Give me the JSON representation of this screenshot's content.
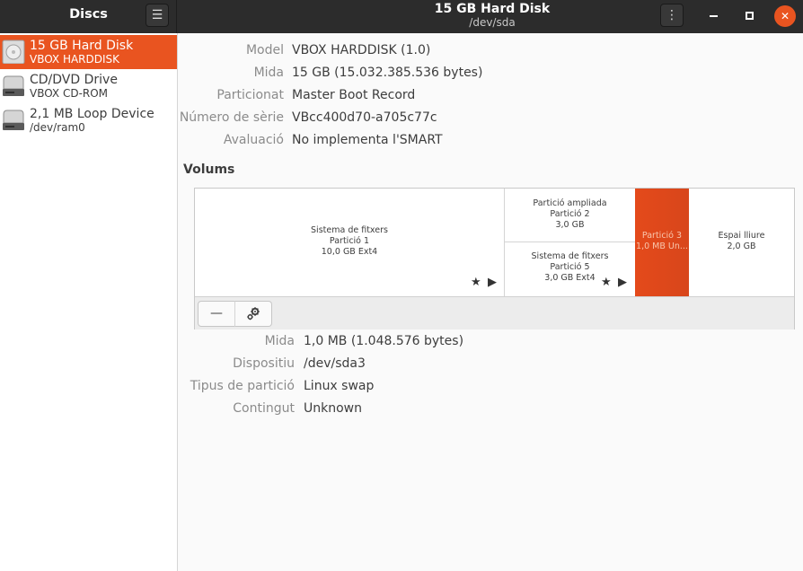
{
  "app": {
    "title": "Discs",
    "menu_icon": "hamburger-menu-icon"
  },
  "header": {
    "disk_title": "15 GB Hard Disk",
    "disk_path": "/dev/sda",
    "kebab_icon": "vertical-ellipsis-icon"
  },
  "window_controls": {
    "minimize": "minimize-icon",
    "maximize": "maximize-icon",
    "close": "✕"
  },
  "sidebar": {
    "items": [
      {
        "name": "15 GB Hard Disk",
        "sub": "VBOX HARDDISK",
        "selected": true,
        "icon": "hard-disk-icon"
      },
      {
        "name": "CD/DVD Drive",
        "sub": "VBOX CD-ROM",
        "selected": false,
        "icon": "optical-drive-icon"
      },
      {
        "name": "2,1 MB Loop Device",
        "sub": "/dev/ram0",
        "selected": false,
        "icon": "loop-device-icon"
      }
    ]
  },
  "disk_info": [
    {
      "label": "Model",
      "value": "VBOX HARDDISK (1.0)"
    },
    {
      "label": "Mida",
      "value": "15 GB (15.032.385.536 bytes)"
    },
    {
      "label": "Particionat",
      "value": "Master Boot Record"
    },
    {
      "label": "Número de sèrie",
      "value": "VBcc400d70-a705c77c"
    },
    {
      "label": "Avaluació",
      "value": "No implementa l'SMART"
    }
  ],
  "volumes": {
    "title": "Volums",
    "partitions": [
      {
        "line1": "Sistema de fitxers",
        "line2": "Partició 1",
        "line3": "10,0 GB Ext4"
      },
      {
        "line1": "Partició ampliada",
        "line2": "Partició 2",
        "line3": "3,0 GB"
      },
      {
        "line1": "Sistema de fitxers",
        "line2": "Partició 5",
        "line3": "3,0 GB Ext4"
      },
      {
        "line1": "Partició 3",
        "line2": "1,0 MB Un...",
        "line3": ""
      },
      {
        "line1": "Espai lliure",
        "line2": "2,0 GB",
        "line3": ""
      }
    ],
    "star_glyph": "★",
    "play_glyph": "▶",
    "toolbar": {
      "remove_label": "—",
      "settings_icon": "gears-icon"
    }
  },
  "partition_info": [
    {
      "label": "Mida",
      "value": "1,0 MB (1.048.576 bytes)"
    },
    {
      "label": "Dispositiu",
      "value": "/dev/sda3"
    },
    {
      "label": "Tipus de partició",
      "value": "Linux swap"
    },
    {
      "label": "Contingut",
      "value": "Unknown"
    }
  ],
  "colors": {
    "accent": "#e95420",
    "header": "#2c2c2c",
    "label_gray": "#8b8b8b"
  }
}
